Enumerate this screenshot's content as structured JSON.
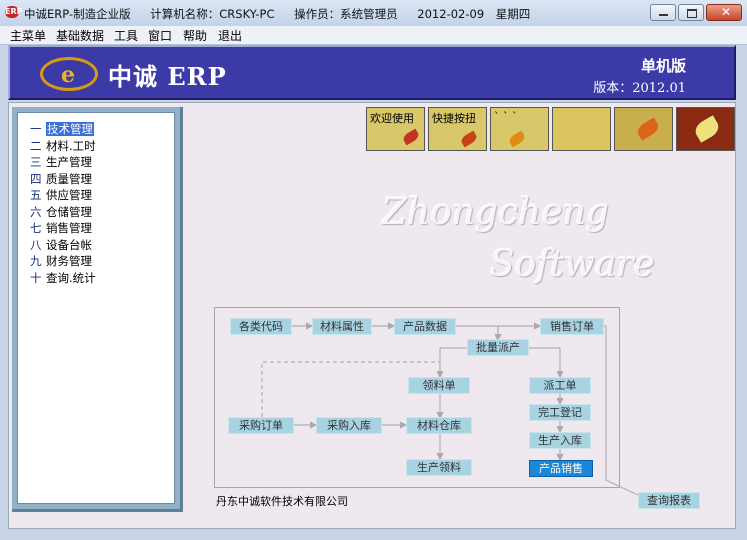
{
  "window": {
    "title": "中诚ERP-制造企业版",
    "computer": "计算机名称：CRSKY-PC",
    "operator": "操作员：系统管理员",
    "date": "2012-02-09",
    "weekday": "星期四",
    "app_icon_text": "ERP"
  },
  "menu": [
    "主菜单",
    "基础数据",
    "工具",
    "窗口",
    "帮助",
    "退出"
  ],
  "banner": {
    "logo_letter": "e",
    "logo_text": "中诚 ERP",
    "edition": "单机版",
    "version": "版本：2012.01",
    "bg_color": "#3c3aa6"
  },
  "nav": [
    {
      "num": "一",
      "label": "技术管理",
      "selected": true
    },
    {
      "num": "二",
      "label": "材料.工时"
    },
    {
      "num": "三",
      "label": "生产管理"
    },
    {
      "num": "四",
      "label": "质量管理"
    },
    {
      "num": "五",
      "label": "供应管理"
    },
    {
      "num": "六",
      "label": "仓储管理"
    },
    {
      "num": "七",
      "label": "销售管理"
    },
    {
      "num": "八",
      "label": "设备台帐"
    },
    {
      "num": "九",
      "label": "财务管理"
    },
    {
      "num": "十",
      "label": "查询.统计"
    }
  ],
  "thumbs": [
    {
      "caption": "欢迎使用"
    },
    {
      "caption": "快捷按扭"
    },
    {
      "caption": "` ` `"
    },
    {
      "caption": ""
    },
    {
      "caption": ""
    },
    {
      "caption": ""
    }
  ],
  "watermark": {
    "line1": "Zhongcheng",
    "line2": "Software"
  },
  "flow": {
    "category_code": "各类代码",
    "material_attr": "材料属性",
    "product_data": "产品数据",
    "sales_order": "销售订单",
    "batch_produce": "批量派产",
    "material_req": "领料单",
    "dispatch": "派工单",
    "purchase_order": "采购订单",
    "purchase_in": "采购入库",
    "material_store": "材料仓库",
    "completion": "完工登记",
    "production_in": "生产入库",
    "production_pick": "生产领料",
    "product_sales": "产品销售",
    "query_report": "查询报表"
  },
  "company": "丹东中诚软件技术有限公司"
}
